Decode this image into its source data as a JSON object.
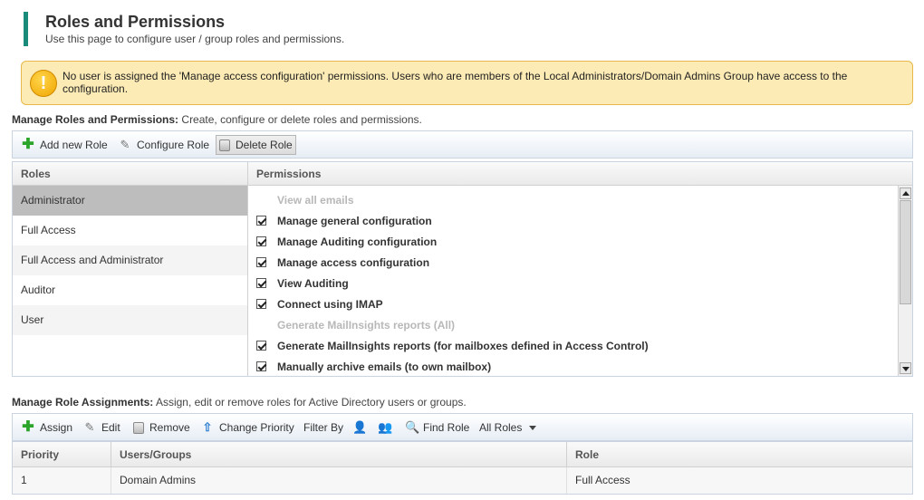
{
  "header": {
    "title": "Roles and Permissions",
    "subtitle": "Use this page to configure user / group roles and permissions."
  },
  "warning": {
    "text": "No user is assigned the 'Manage access configuration' permissions. Users who are members of the Local Administrators/Domain Admins Group have access to the configuration."
  },
  "roles_section": {
    "label_bold": "Manage Roles and Permissions:",
    "label_rest": " Create, configure or delete roles and permissions.",
    "toolbar": {
      "add_label": "Add new Role",
      "configure_label": "Configure Role",
      "delete_label": "Delete Role"
    },
    "roles_header": "Roles",
    "permissions_header": "Permissions",
    "roles": [
      {
        "label": "Administrator"
      },
      {
        "label": "Full Access"
      },
      {
        "label": "Full Access and Administrator"
      },
      {
        "label": "Auditor"
      },
      {
        "label": "User"
      }
    ],
    "selected_role": "Administrator",
    "permissions": [
      {
        "label": "View all emails",
        "checked": false,
        "enabled": false
      },
      {
        "label": "Manage general configuration",
        "checked": true,
        "enabled": true
      },
      {
        "label": "Manage Auditing configuration",
        "checked": true,
        "enabled": true
      },
      {
        "label": "Manage access configuration",
        "checked": true,
        "enabled": true
      },
      {
        "label": "View Auditing",
        "checked": true,
        "enabled": true
      },
      {
        "label": "Connect using IMAP",
        "checked": true,
        "enabled": true
      },
      {
        "label": "Generate MailInsights reports (All)",
        "checked": false,
        "enabled": false
      },
      {
        "label": "Generate MailInsights reports (for mailboxes defined in Access Control)",
        "checked": true,
        "enabled": true
      },
      {
        "label": "Manually archive emails (to own mailbox)",
        "checked": true,
        "enabled": true
      }
    ]
  },
  "assignments_section": {
    "label_bold": "Manage Role Assignments:",
    "label_rest": " Assign, edit or remove roles for Active Directory users or groups.",
    "toolbar": {
      "assign_label": "Assign",
      "edit_label": "Edit",
      "remove_label": "Remove",
      "change_priority_label": "Change Priority",
      "filter_by_label": "Filter By",
      "find_role_label": "Find Role",
      "roles_filter_value": "All Roles"
    },
    "columns": [
      "Priority",
      "Users/Groups",
      "Role"
    ],
    "rows": [
      {
        "priority": "1",
        "users_groups": "Domain Admins",
        "role": "Full Access"
      }
    ]
  },
  "colors": {
    "accent_bar": "#1a8a7a",
    "warning_bg": "#fdebb5",
    "selected_row": "#bdbdbd"
  }
}
